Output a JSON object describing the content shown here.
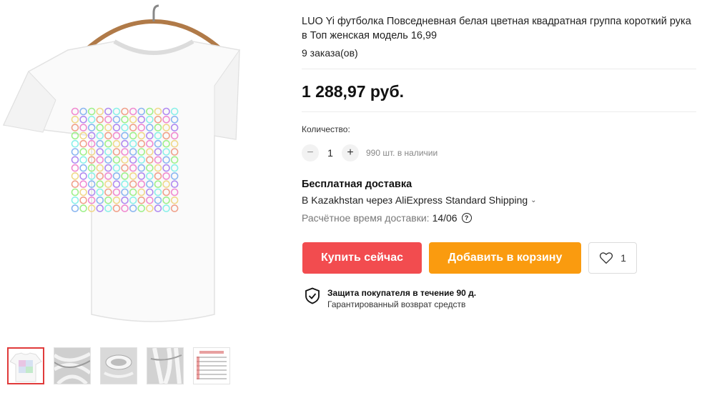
{
  "product": {
    "title": "LUO Yi футболка Повседневная белая цветная квадратная группа короткий рука в Топ женская модель 16,99",
    "orders": "9 заказа(ов)",
    "price": "1 288,97 руб."
  },
  "quantity": {
    "label": "Количество:",
    "value": "1",
    "stock": "990 шт. в наличии",
    "minus_symbol": "−",
    "plus_symbol": "+"
  },
  "shipping": {
    "title": "Бесплатная доставка",
    "method": "В Kazakhstan через AliExpress Standard Shipping",
    "time_label": "Расчётное время доставки:",
    "time_date": "14/06",
    "help_symbol": "?",
    "chevron_symbol": "⌄"
  },
  "actions": {
    "buy_now": "Купить сейчас",
    "add_to_cart": "Добавить в корзину",
    "wishlist_count": "1"
  },
  "protection": {
    "title": "Защита покупателя в течение 90 д.",
    "subtitle": "Гарантированный возврат средств"
  },
  "gallery": {
    "thumbnails": [
      "tshirt-front",
      "fabric-detail-1",
      "collar-detail",
      "fabric-detail-2",
      "size-chart"
    ],
    "selected_index": 0
  },
  "colors": {
    "buy_button": "#f24c4f",
    "cart_button": "#fa9b0f",
    "selected_thumb_border": "#e03a3a"
  }
}
